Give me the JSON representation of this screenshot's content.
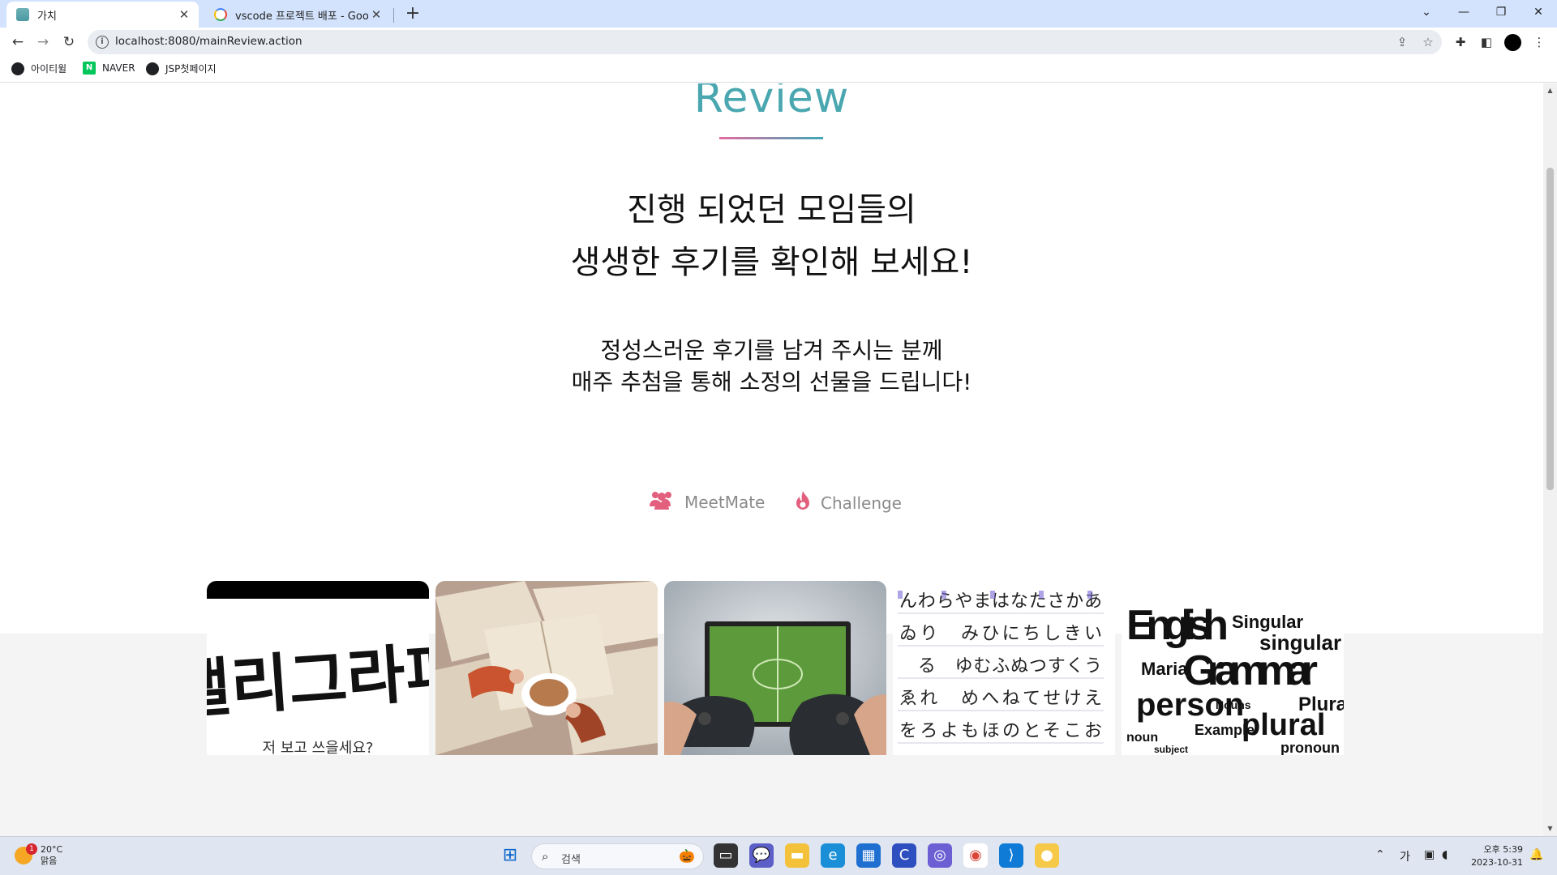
{
  "browser": {
    "tabs": [
      {
        "title": "가치",
        "active": true
      },
      {
        "title": "vscode 프로젝트 배포 - Google",
        "active": false
      }
    ],
    "new_tab": "+",
    "url": "localhost:8080/mainReview.action",
    "bookmarks": [
      {
        "label": "아이티윌",
        "icon": "globe-icon"
      },
      {
        "label": "NAVER",
        "icon": "naver-icon"
      },
      {
        "label": "JSP첫페이지",
        "icon": "globe-icon"
      }
    ]
  },
  "page": {
    "section_title": "Review",
    "headline_line1": "진행 되었던 모임들의",
    "headline_line2": "생생한 후기를 확인해 보세요!",
    "sub_line1": "정성스러운 후기를 남겨 주시는 분께",
    "sub_line2": "매주 추첨을 통해 소정의 선물을 드립니다!",
    "categories": [
      {
        "label": "MeetMate",
        "icon": "users-icon"
      },
      {
        "label": "Challenge",
        "icon": "fire-icon"
      }
    ],
    "cards": [
      {
        "name": "calligraphy",
        "text": "캘리그라피",
        "caption": "저 보고 쓰을세요?"
      },
      {
        "name": "books-coffee"
      },
      {
        "name": "gaming-controllers"
      },
      {
        "name": "japanese-hiragana-chart",
        "text": "んわらやまはなたさかあ"
      },
      {
        "name": "english-grammar-wordcloud",
        "words": [
          "English",
          "Singular",
          "singular",
          "Grammar",
          "person",
          "plural",
          "Plural",
          "Example",
          "Nouns",
          "noun",
          "subject",
          "pronoun",
          "Maria"
        ]
      }
    ],
    "accent_color": "#4aa7b0",
    "icon_color": "#e2607e"
  },
  "taskbar": {
    "weather_temp": "20°C",
    "weather_desc": "맑음",
    "weather_badge": "1",
    "search_label": "검색",
    "ime": "가",
    "time": "오후 5:39",
    "date": "2023-10-31"
  }
}
